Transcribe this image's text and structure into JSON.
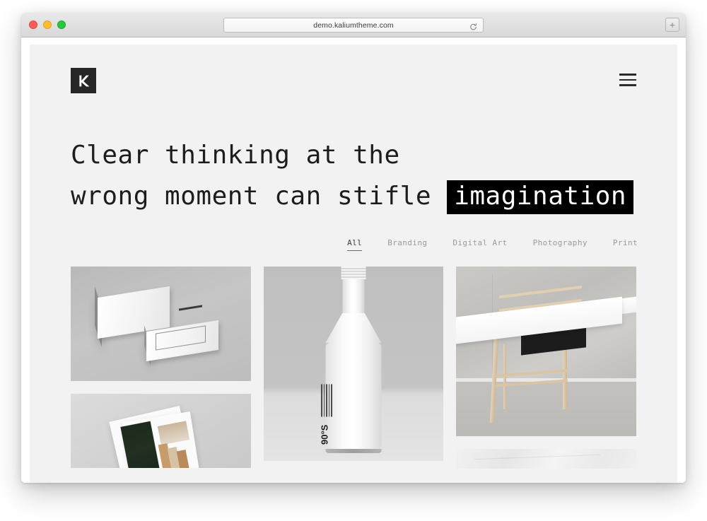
{
  "browser": {
    "url": "demo.kaliumtheme.com",
    "reload_icon": "reload-icon",
    "newtab_label": "+",
    "traffic_lights": [
      "close",
      "minimize",
      "maximize"
    ]
  },
  "site": {
    "logo_alt": "K",
    "menu_icon": "hamburger-menu-icon"
  },
  "hero": {
    "line1": "Clear thinking at the",
    "line2_prefix": "wrong moment can stifle",
    "line2_highlight": "imagination",
    "highlight_bg": "#000000",
    "highlight_color": "#ffffff"
  },
  "filters": {
    "items": [
      {
        "label": "All",
        "active": true
      },
      {
        "label": "Branding",
        "active": false
      },
      {
        "label": "Digital Art",
        "active": false
      },
      {
        "label": "Photography",
        "active": false
      },
      {
        "label": "Print",
        "active": false
      }
    ]
  },
  "portfolio": {
    "items": [
      {
        "name": "business-cards-mockup",
        "column": 1
      },
      {
        "name": "magazine-brochure-mockup",
        "column": 1
      },
      {
        "name": "bottle-packaging-mockup",
        "column": 2,
        "label": "90°S"
      },
      {
        "name": "white-desk-furniture",
        "column": 3
      },
      {
        "name": "marble-texture",
        "column": 3
      }
    ]
  },
  "colors": {
    "page_bg": "#f2f2f2",
    "logo_bg": "#262626",
    "text": "#1d1d1d",
    "filter_inactive": "#9a9a9a",
    "filter_active": "#3a3a3a"
  }
}
